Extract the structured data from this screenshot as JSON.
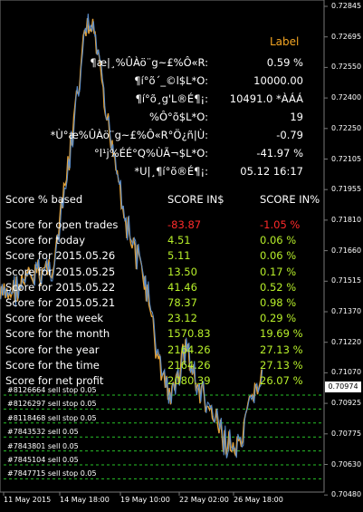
{
  "window": {
    "title_fragment": ""
  },
  "label": {
    "title": "Label"
  },
  "info_rows": [
    {
      "key": "¶æ|¸%ÛÀö¨g~£%Ô«R:",
      "value": "0.59 %"
    },
    {
      "key": "¶í°õ´_©l$L*O:",
      "value": "10000.00"
    },
    {
      "key": "¶í°õ¸g'L®É¶¡:",
      "value": "10491.0 *ÀÁÁ"
    },
    {
      "key": "%Ô°õ$L*O:",
      "value": "19"
    },
    {
      "key": "*Ù°æ%ÛÀö¨g~£%Ô«R°Ö¿ñ|Ù:",
      "value": "-0.79"
    },
    {
      "key": "°l¹j%ÉÉ°Q%ÙÃ¬$L*O:",
      "value": "-41.97 %"
    },
    {
      "key": "*U|¸¶í°õ®É¶¡:",
      "value": "05.12 16:17"
    }
  ],
  "score_header": {
    "name": "Score % based",
    "money": "SCORE IN$",
    "pct": "SCORE IN%"
  },
  "score_rows": [
    {
      "name": "Score for open trades",
      "money": "-83.87",
      "pct": "-1.05 %",
      "color": "#ff2a2a"
    },
    {
      "name": "Score for today",
      "money": "4.51",
      "pct": "0.06 %",
      "color": "#b8f02a"
    },
    {
      "name": "Score for 2015.05.26",
      "money": "5.11",
      "pct": "0.06 %",
      "color": "#b8f02a"
    },
    {
      "name": "Score for 2015.05.25",
      "money": "13.50",
      "pct": "0.17 %",
      "color": "#b8f02a"
    },
    {
      "name": "Score for 2015.05.22",
      "money": "41.46",
      "pct": "0.52 %",
      "color": "#b8f02a"
    },
    {
      "name": "Score for 2015.05.21",
      "money": "78.37",
      "pct": "0.98 %",
      "color": "#b8f02a"
    },
    {
      "name": "Score for the week",
      "money": "23.12",
      "pct": "0.29 %",
      "color": "#b8f02a"
    },
    {
      "name": "Score for the month",
      "money": "1570.83",
      "pct": "19.69 %",
      "color": "#b8f02a"
    },
    {
      "name": "Score for the year",
      "money": "2164.26",
      "pct": "27.13 %",
      "color": "#b8f02a"
    },
    {
      "name": "Score for the time",
      "money": "2164.26",
      "pct": "27.13 %",
      "color": "#b8f02a"
    },
    {
      "name": "Score for net profit",
      "money": "2080.39",
      "pct": "26.07 %",
      "color": "#b8f02a"
    }
  ],
  "orders": [
    "#8126664 sell stop 0.05",
    "#8126297 sell stop 0.05",
    "#8118468 sell stop 0.05",
    "#7843532 sell 0.05",
    "#7843801 sell 0.05",
    "#7845104 sell 0.05",
    "#7847715 sell stop 0.05"
  ],
  "price_axis": [
    "0.72845",
    "0.72695",
    "0.72550",
    "0.72400",
    "0.72250",
    "0.72105",
    "0.71955",
    "0.71810",
    "0.71660",
    "0.71515",
    "0.71370",
    "0.71220",
    "0.71070",
    "0.70925",
    "0.70775",
    "0.70630",
    "0.70480"
  ],
  "current_price": "0.70974",
  "date_axis": [
    "11 May 2015",
    "14 May 18:00",
    "19 May 10:00",
    "22 May 02:00",
    "26 May 18:00"
  ],
  "colors": {
    "background": "#000000",
    "candle": "#e3a23a",
    "candle_alt": "#5a8fd0",
    "order_line": "#29c229",
    "text": "#ffffff",
    "label_orange": "#f5a623",
    "positive": "#b8f02a",
    "negative": "#ff2a2a"
  }
}
